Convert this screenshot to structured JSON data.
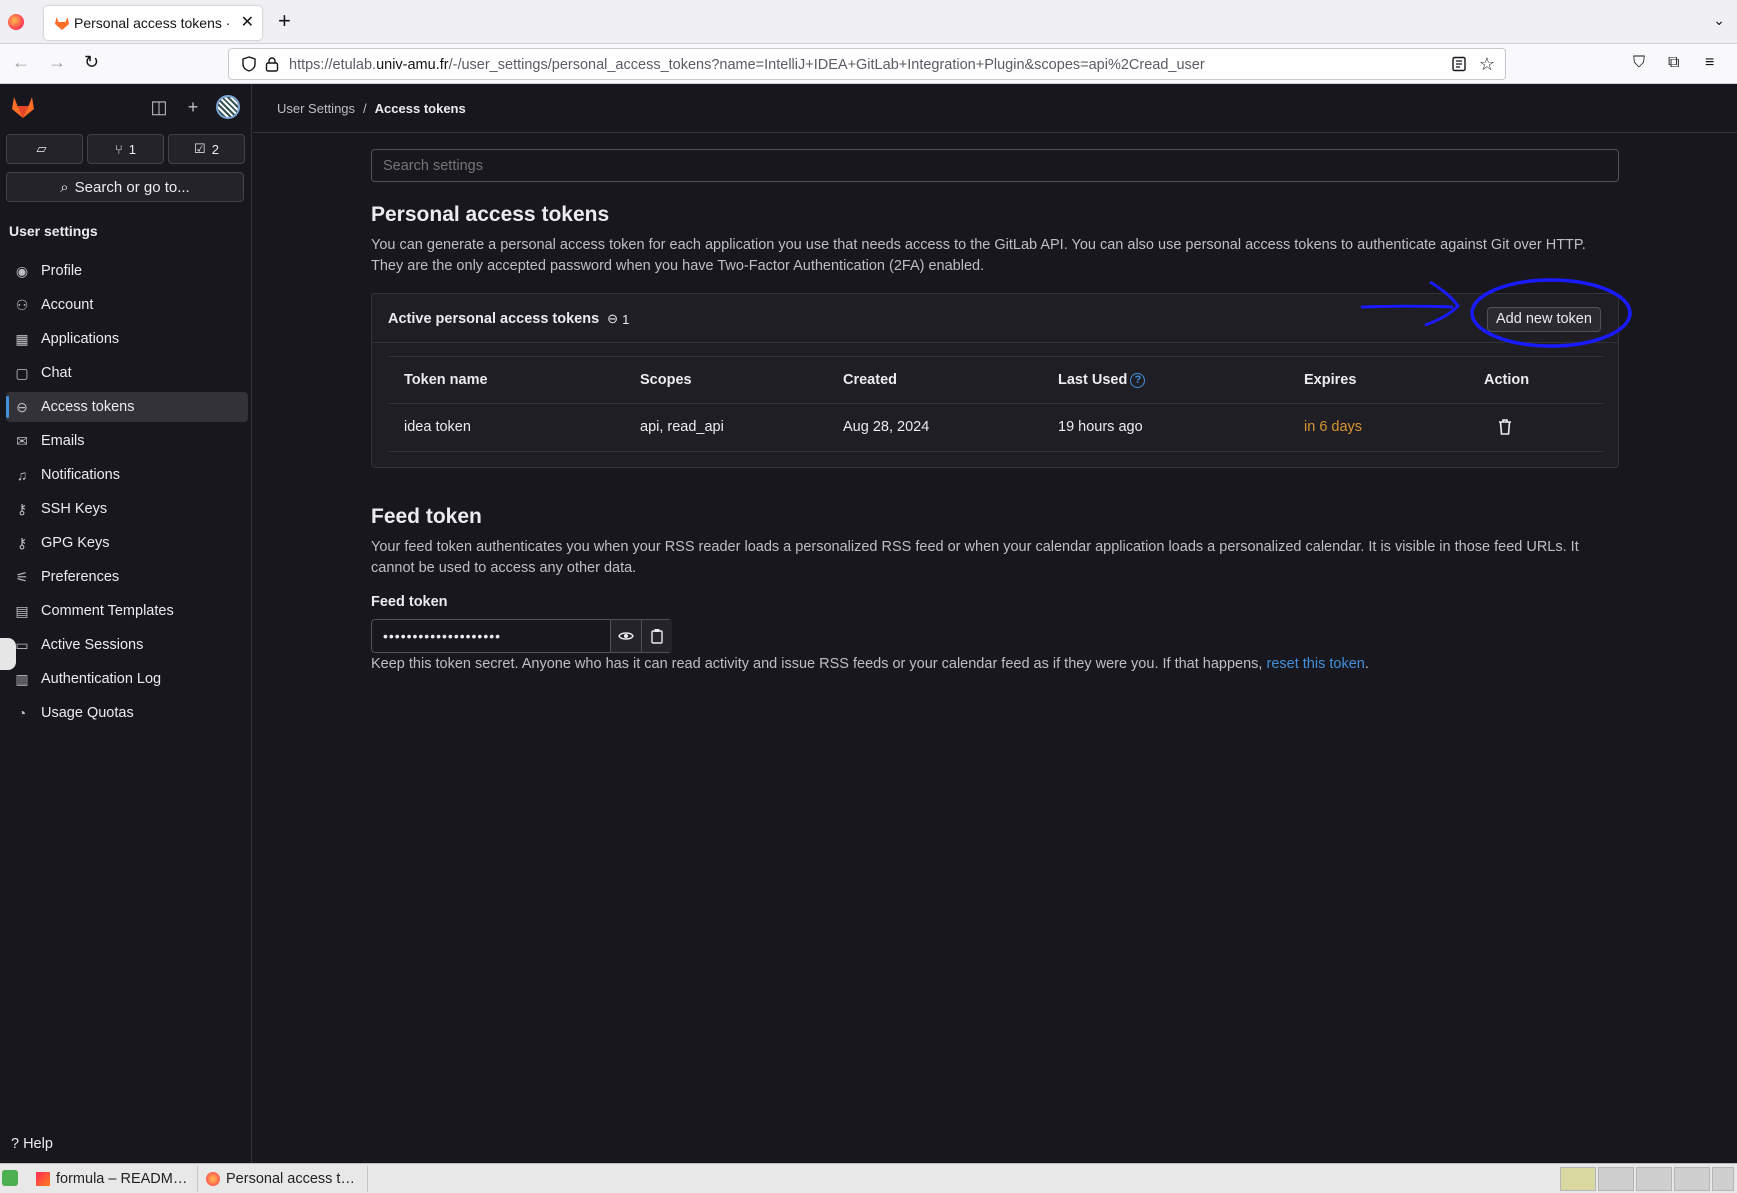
{
  "browser": {
    "tab_title": "Personal access tokens · U",
    "new_tab": "+",
    "url_prefix": "https://etulab.",
    "url_domain": "univ-amu.fr",
    "url_path": "/-/user_settings/personal_access_tokens?name=IntelliJ+IDEA+GitLab+Integration+Plugin&scopes=api%2Cread_user"
  },
  "sidebar": {
    "counters": [
      {
        "icon": "issues-icon",
        "value": ""
      },
      {
        "icon": "merge-request-icon",
        "value": "1"
      },
      {
        "icon": "todo-icon",
        "value": "2"
      }
    ],
    "search_label": "Search or go to...",
    "heading": "User settings",
    "items": [
      {
        "label": "Profile",
        "icon": "profile-icon"
      },
      {
        "label": "Account",
        "icon": "account-icon"
      },
      {
        "label": "Applications",
        "icon": "applications-icon"
      },
      {
        "label": "Chat",
        "icon": "chat-icon"
      },
      {
        "label": "Access tokens",
        "icon": "token-icon",
        "active": true
      },
      {
        "label": "Emails",
        "icon": "mail-icon"
      },
      {
        "label": "Notifications",
        "icon": "bell-icon"
      },
      {
        "label": "SSH Keys",
        "icon": "key-icon"
      },
      {
        "label": "GPG Keys",
        "icon": "key-icon"
      },
      {
        "label": "Preferences",
        "icon": "preferences-icon"
      },
      {
        "label": "Comment Templates",
        "icon": "comment-templates-icon"
      },
      {
        "label": "Active Sessions",
        "icon": "sessions-icon"
      },
      {
        "label": "Authentication Log",
        "icon": "log-icon"
      },
      {
        "label": "Usage Quotas",
        "icon": "quota-icon"
      }
    ],
    "help": "Help"
  },
  "breadcrumb": {
    "root": "User Settings",
    "separator": "/",
    "current": "Access tokens"
  },
  "main": {
    "search_placeholder": "Search settings",
    "pat_title": "Personal access tokens",
    "pat_desc": "You can generate a personal access token for each application you use that needs access to the GitLab API. You can also use personal access tokens to authenticate against Git over HTTP. They are the only accepted password when you have Two-Factor Authentication (2FA) enabled.",
    "active_title": "Active personal access tokens",
    "active_count": "1",
    "add_button": "Add new token",
    "table": {
      "headers": [
        "Token name",
        "Scopes",
        "Created",
        "Last Used",
        "Expires",
        "Action"
      ],
      "rows": [
        {
          "name": "idea token",
          "scopes": "api, read_api",
          "created": "Aug 28, 2024",
          "last_used": "19 hours ago",
          "expires": "in 6 days"
        }
      ]
    },
    "feed_title": "Feed token",
    "feed_desc": "Your feed token authenticates you when your RSS reader loads a personalized RSS feed or when your calendar application loads a personalized calendar. It is visible in those feed URLs. It cannot be used to access any other data.",
    "feed_label": "Feed token",
    "feed_value": "••••••••••••••••••••",
    "keep_text": "Keep this token secret. Anyone who has it can read activity and issue RSS feeds or your calendar feed as if they were you. If that happens, ",
    "reset_link": "reset this token",
    "keep_end": "."
  },
  "taskbar": {
    "tasks": [
      "formula – READM…",
      "Personal access t…"
    ]
  },
  "colors": {
    "accent": "#428fdc",
    "warning": "#d99530",
    "annotation": "#1a1aff"
  }
}
